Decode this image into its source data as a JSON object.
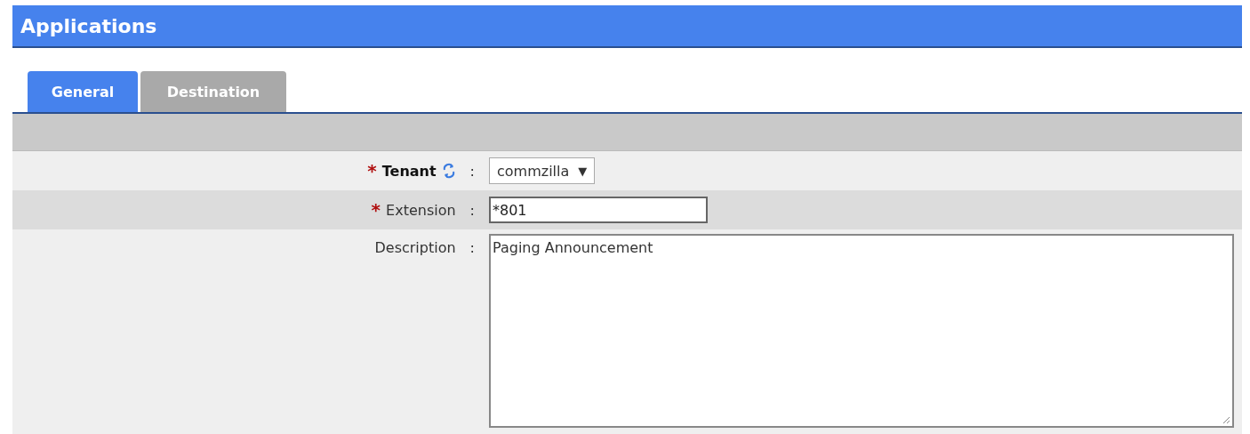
{
  "header": {
    "title": "Applications"
  },
  "tabs": [
    {
      "label": "General",
      "selected": true
    },
    {
      "label": "Destination",
      "selected": false
    }
  ],
  "fields": [
    {
      "kind": "select",
      "marker": "*",
      "label": "Tenant",
      "separator": ":",
      "value": "commzilla",
      "arrow": "▼"
    },
    {
      "kind": "text",
      "marker": "*",
      "label": "Extension",
      "separator": ":",
      "value": "*801"
    },
    {
      "kind": "textarea",
      "label": "Description",
      "separator": ":",
      "value": "Paging Announcement"
    }
  ]
}
